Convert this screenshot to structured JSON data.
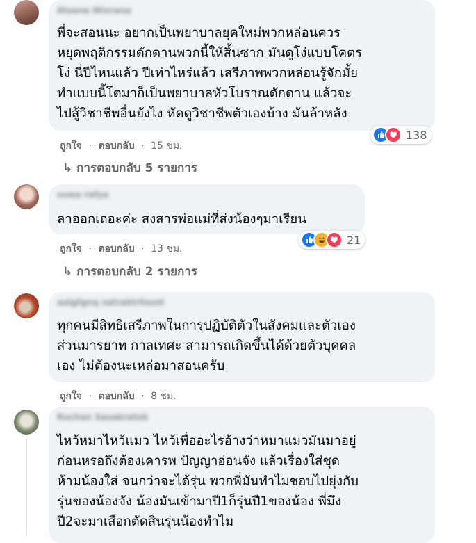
{
  "comments": [
    {
      "author": "Aluena Wixrana",
      "text": "พี่จะสอนนะ อยากเป็นพยาบาลยุคใหม่พวกหล่อนควร\nหยุดพฤติกรรมดักดานพวกนี้ให้สิ้นซาก มันดูโง่แบบโคตร\nโง่ นี่ปีไหนแล้ว ปีเท่าไหร่แล้ว เสรีภาพพวกหล่อนรู้จักมั้ย\nทำแบบนี้โตมาก็เป็นพยาบาลหัวโบราณดักดาน แล้วจะ\nไปสู้วิชาชีพอื่นยังไง หัดดูวิชาชีพตัวเองบ้าง มันล้าหลัง",
      "like": "ถูกใจ",
      "reply": "ตอบกลับ",
      "time": "15 ชม.",
      "reactions_count": "138",
      "replies": "การตอบกลับ 5 รายการ"
    },
    {
      "author": "suwa rafya",
      "text": "ลาออกเถอะค่ะ สงสารพ่อแม่ที่ส่งน้องๆมาเรียน",
      "like": "ถูกใจ",
      "reply": "ตอบกลับ",
      "time": "13 ชม.",
      "reactions_count": "21",
      "replies": "การตอบกลับ 2 รายการ"
    },
    {
      "author": "aalgfgnq satraktrfoont",
      "text": "ทุกคนมีสิทธิเสรีภาพในการปฏิบัติตัวในสังคมและตัวเอง\nส่วนมารยาท กาลเทศะ สามารถเกิดขึ้นได้ด้วยตัวบุคคล\nเอง ไม่ต้องนะเหล่อมาสอนครับ",
      "like": "ถูกใจ",
      "reply": "ตอบกลับ",
      "time": "8 ชม."
    },
    {
      "author": "Ruchan Saoakratok",
      "text": "ไหว้หมาไหว้แมว ไหว้เพื่ออะไรอ้างว่าหมาแมวมันมาอยู่\nก่อนหรอถึงต้องเคารพ ปัญญาอ่อนจัง แล้วเรื่องใส่ชุด\nห้ามน้องใส่ จนกว่าจะได้รุ่น พวกพี่มันทำไมชอบไปยุ่งกับ\nรุ่นของน้องจัง น้องมันเข้ามาปี1ก็รุ่นปี1ของน้อง พี่มึง\nปี2จะมาเสือกตัดสินรุ่นน้องทำไม"
    }
  ],
  "separator": "·",
  "reply_arrow": "↳",
  "colors": {
    "like": "#1877f2",
    "love": "#f33e58",
    "haha": "#f7b125",
    "bubble": "#f0f2f5",
    "meta": "#65676b"
  }
}
